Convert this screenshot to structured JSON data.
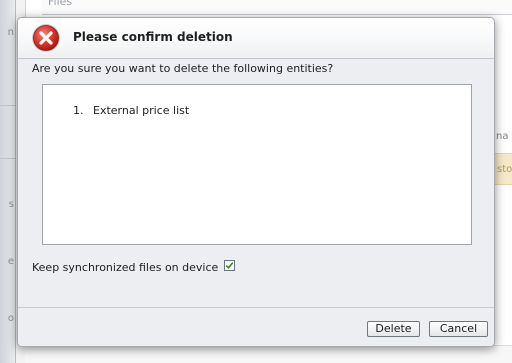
{
  "background": {
    "top_field_text": "Files",
    "left_fragments": [
      "n",
      "s",
      "e",
      "o"
    ],
    "right_label": "na",
    "right_badge": "sto"
  },
  "dialog": {
    "title": "Please confirm deletion",
    "icon": "error-x-icon",
    "prompt": "Are you sure you want to delete the following entities?",
    "entities": [
      {
        "number": "1.",
        "name": "External price list"
      }
    ],
    "keep_files_label": "Keep synchronized files on device",
    "keep_files_checked": true,
    "buttons": {
      "delete": "Delete",
      "cancel": "Cancel"
    }
  },
  "colors": {
    "icon_red": "#d9312b",
    "check_green": "#2f8a1e",
    "badge_bg": "#f6e9c9"
  }
}
